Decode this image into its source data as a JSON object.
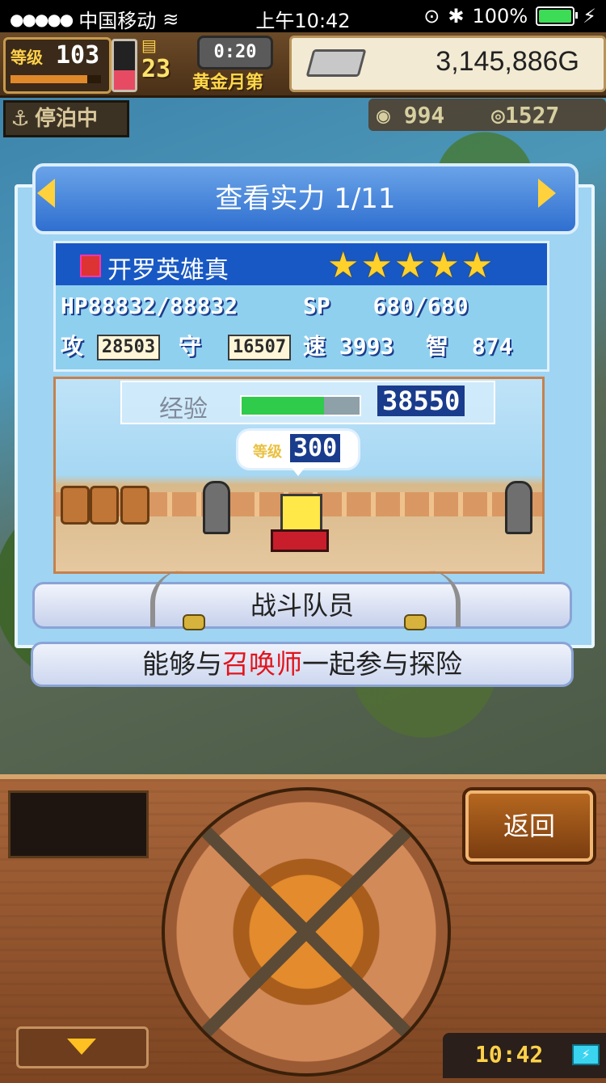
{
  "statusbar": {
    "signal": "●●●●●",
    "carrier": "中国移动",
    "time": "上午10:42",
    "battery": "100%"
  },
  "hud": {
    "level_label": "等级",
    "level_value": "103",
    "week_value": "23",
    "timer": "0:20",
    "month_label": "黄金月第",
    "gold": "3,145,886G",
    "docked": "停泊中",
    "res1": "994",
    "res2": "1527",
    "level_progress": 0.85,
    "red_gauge": 0.4
  },
  "dialog": {
    "title": "查看实力 1/11",
    "unit_name": "开罗英雄真",
    "stars": "★★★★★",
    "hp_label": "HP",
    "hp_value": "88832/88832",
    "sp_label": "SP",
    "sp_value": "680/680",
    "atk_label": "攻",
    "atk_value": "28503",
    "def_label": "守",
    "def_value": "16507",
    "spd_label": "速",
    "spd_value": "3993",
    "int_label": "智",
    "int_value": "874",
    "exp_label": "经验",
    "exp_value": "38550",
    "exp_progress": 0.7,
    "bubble_level_label": "等级",
    "bubble_level_value": "300",
    "role": "战斗队员",
    "desc_pre": "能够与",
    "desc_highlight": "召唤师",
    "desc_post": "一起参与探险"
  },
  "bottom": {
    "back": "返回",
    "clock": "10:42"
  },
  "colors": {
    "accent_blue": "#2f6fd0",
    "highlight_red": "#e2141c",
    "star_gold": "#ffd12a"
  }
}
